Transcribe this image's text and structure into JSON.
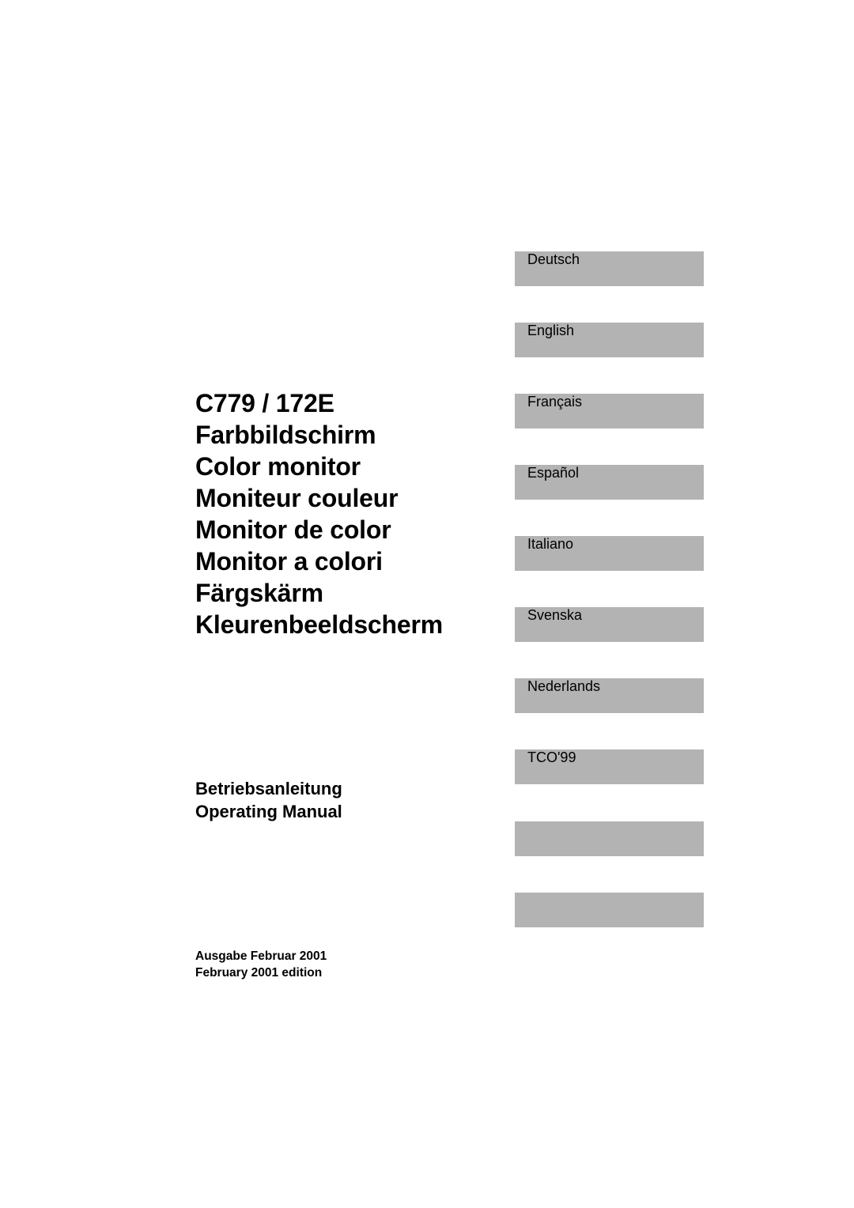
{
  "title_lines": [
    "C779 / 172E",
    "Farbbildschirm",
    "Color monitor",
    "Moniteur couleur",
    "Monitor de color",
    "Monitor a colori",
    "Färgskärm",
    "Kleurenbeeldscherm"
  ],
  "subtitle_lines": [
    "Betriebsanleitung",
    "Operating Manual"
  ],
  "edition_lines": [
    "Ausgabe Februar 2001",
    "February 2001 edition"
  ],
  "tabs": [
    {
      "label": "Deutsch"
    },
    {
      "label": "English"
    },
    {
      "label": "Français"
    },
    {
      "label": "Español"
    },
    {
      "label": "Italiano"
    },
    {
      "label": "Svenska"
    },
    {
      "label": "Nederlands"
    },
    {
      "label": "TCO'99"
    },
    {
      "label": ""
    },
    {
      "label": ""
    }
  ],
  "colors": {
    "tab_background": "#b3b3b3",
    "text": "#000000",
    "page": "#ffffff"
  }
}
